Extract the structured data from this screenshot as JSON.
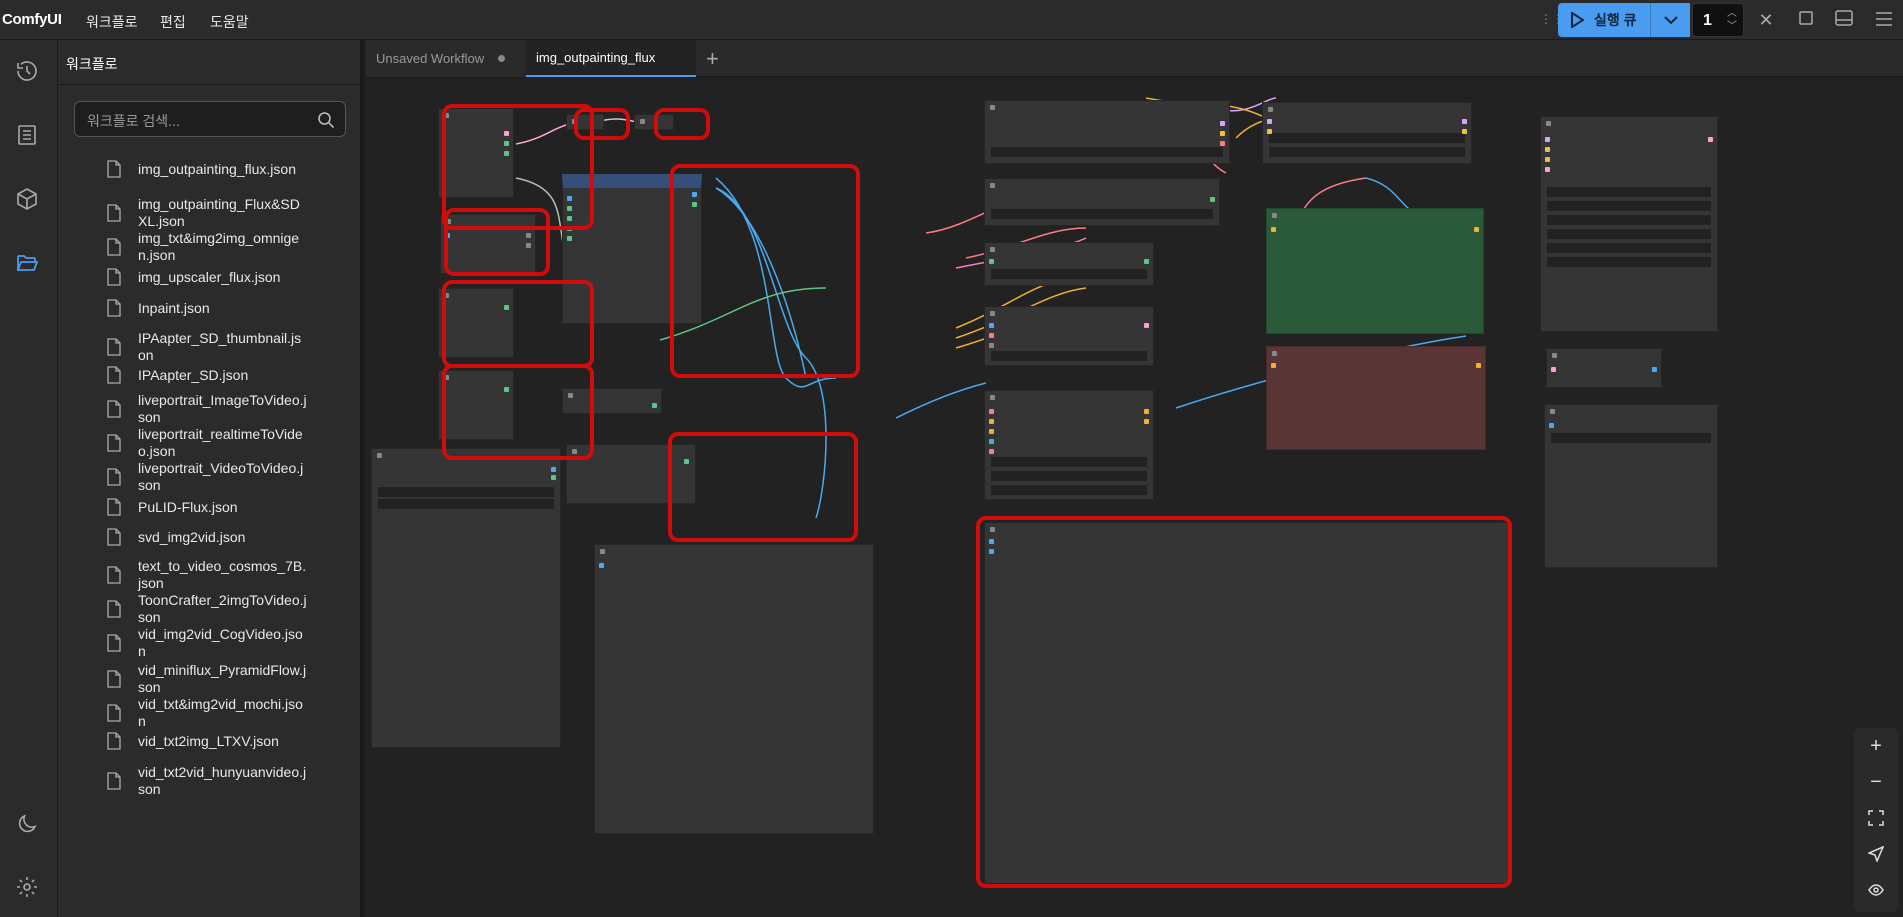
{
  "topbar": {
    "logo": "ComfyUI",
    "menus": [
      "워크플로",
      "편집",
      "도움말"
    ],
    "queue_label": "실행 큐",
    "batch_count": "1"
  },
  "sidebar": {
    "title": "워크플로",
    "search_placeholder": "워크플로 검색...",
    "files": [
      "img_outpainting_flux.json",
      "img_outpainting_Flux&SDXL.json",
      "img_txt&img2img_omnigen.json",
      "img_upscaler_flux.json",
      "Inpaint.json",
      "IPAapter_SD_thumbnail.json",
      "IPAapter_SD.json",
      "liveportrait_ImageToVideo.json",
      "liveportrait_realtimeToVideo.json",
      "liveportrait_VideoToVideo.json",
      "PuLID-Flux.json",
      "svd_img2vid.json",
      "text_to_video_cosmos_7B.json",
      "ToonCrafter_2imgToVideo.json",
      "vid_img2vid_CogVideo.json",
      "vid_miniflux_PyramidFlow.json",
      "vid_txt&img2vid_mochi.json",
      "vid_txt2img_LTXV.json",
      "vid_txt2vid_hunyuanvideo.json"
    ]
  },
  "tabs": [
    {
      "label": "Unsaved Workflow",
      "active": false,
      "modified": true
    },
    {
      "label": "img_outpainting_flux",
      "active": true,
      "modified": false
    }
  ],
  "colors": {
    "accent": "#4a9cf0",
    "highlight": "#d00c0c",
    "node_green": "#2a5a3a",
    "node_red": "#5a3535"
  }
}
